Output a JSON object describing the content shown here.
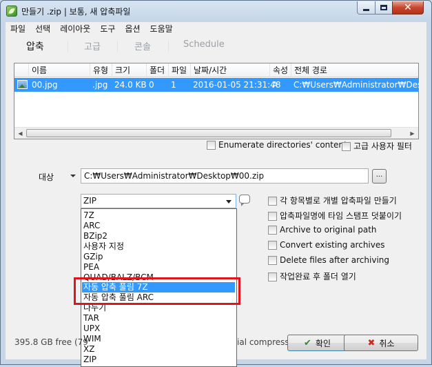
{
  "window": {
    "title": "만들기 .zip | 보통, 새 압축파일",
    "controls": {
      "minimize": "",
      "maximize": "",
      "close": "✕"
    }
  },
  "menu": [
    "파일",
    "선택",
    "레이아웃",
    "도구",
    "옵션",
    "도움말"
  ],
  "tabs": [
    "압축",
    "고급",
    "콘솔",
    "Schedule"
  ],
  "file_list": {
    "columns": [
      "이름",
      "유형",
      "크기",
      "폴더",
      "파일",
      "날짜/시간",
      "속성",
      "전체 경로"
    ],
    "rows": [
      {
        "name": "00.jpg",
        "type": ".jpg",
        "size": "24.0 KB",
        "folders": "0",
        "files": "1",
        "datetime": "2016-01-05 21:31:48",
        "attr": "A",
        "path": "C:₩Users₩Administrator₩Desk"
      }
    ]
  },
  "list_options": {
    "enumerate": "Enumerate directories' content",
    "advanced_filter": "고급 사용자 필터"
  },
  "target": {
    "label": "대상",
    "path": "C:₩Users₩Administrator₩Desktop₩00.zip",
    "browse": "..."
  },
  "format": {
    "selected": "ZIP",
    "options": [
      "7Z",
      "ARC",
      "BZip2",
      "사용자 지정",
      "GZip",
      "PEA",
      "QUAD/BALZ/BCM",
      "자동 압축 풀림 7Z",
      "자동 압축 풀림 ARC",
      "나누기",
      "TAR",
      "UPX",
      "WIM",
      "XZ",
      "ZIP"
    ],
    "highlighted": "자동 압축 풀림 7Z"
  },
  "options": [
    "각 항목별로 개별 압축파일 만들기",
    "압축파일명에 타임 스탬프 덧붙이기",
    "Archive to original path",
    "Convert existing archives",
    "Delete files after archiving",
    "작업완료 후 폴더 열기"
  ],
  "status": {
    "left": "395.8 GB free (79",
    "right": "ial compress"
  },
  "buttons": {
    "ok": "확인",
    "cancel": "취소"
  }
}
